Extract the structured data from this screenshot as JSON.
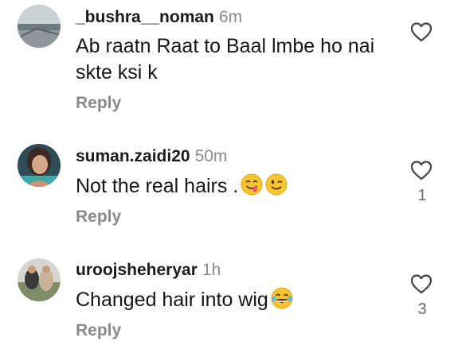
{
  "comments": [
    {
      "username": "_bushra__noman",
      "time": "6m",
      "text": "Ab raatn Raat to Baal lmbe ho nai skte ksi k",
      "reply_label": "Reply",
      "like_count": "",
      "emojis": []
    },
    {
      "username": "suman.zaidi20",
      "time": "50m",
      "text": "Not the real hairs .",
      "reply_label": "Reply",
      "like_count": "1",
      "emojis": [
        "face-savoring-food-icon",
        "winking-face-icon"
      ]
    },
    {
      "username": "uroojsheheryar",
      "time": "1h",
      "text": "Changed hair into wig",
      "reply_label": "Reply",
      "like_count": "3",
      "emojis": [
        "face-with-tears-of-joy-icon"
      ]
    }
  ],
  "icons": {
    "like": "heart-outline-icon"
  },
  "colors": {
    "text": "#161616",
    "muted": "#8a8a8a",
    "emoji": "#f7c531"
  }
}
